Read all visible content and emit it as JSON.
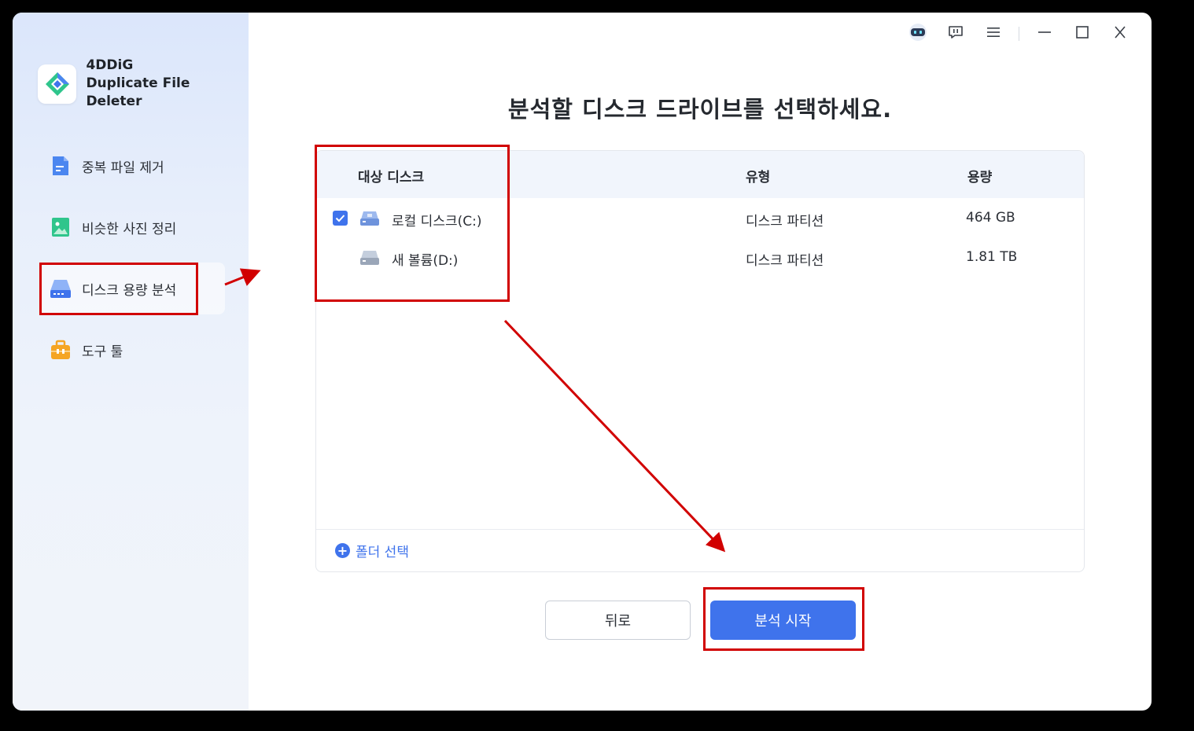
{
  "app": {
    "name": "4DDiG",
    "subtitle": "Duplicate File Deleter"
  },
  "sidebar": {
    "items": [
      {
        "label": "중복 파일 제거",
        "icon": "file-icon"
      },
      {
        "label": "비슷한 사진 정리",
        "icon": "image-icon"
      },
      {
        "label": "디스크 용량 분석",
        "icon": "disk-icon",
        "active": true
      },
      {
        "label": "도구 툴",
        "icon": "toolbox-icon"
      }
    ]
  },
  "titlebar": {
    "icons": [
      "robot-icon",
      "feedback-icon",
      "menu-icon",
      "minimize-icon",
      "maximize-icon",
      "close-icon"
    ]
  },
  "main": {
    "title": "분석할 디스크 드라이브를 선택하세요.",
    "table": {
      "headers": {
        "disk": "대상 디스크",
        "type": "유형",
        "capacity": "용량"
      },
      "rows": [
        {
          "name": "로컬 디스크(C:)",
          "type": "디스크 파티션",
          "capacity": "464 GB",
          "checked": true
        },
        {
          "name": "새 볼륨(D:)",
          "type": "디스크 파티션",
          "capacity": "1.81 TB",
          "checked": false
        }
      ]
    },
    "folder_select": "폴더 선택",
    "buttons": {
      "back": "뒤로",
      "start": "분석 시작"
    }
  },
  "colors": {
    "accent": "#3f73ec",
    "annotation": "#d10000",
    "sidebar_bg": "#e8effb"
  }
}
